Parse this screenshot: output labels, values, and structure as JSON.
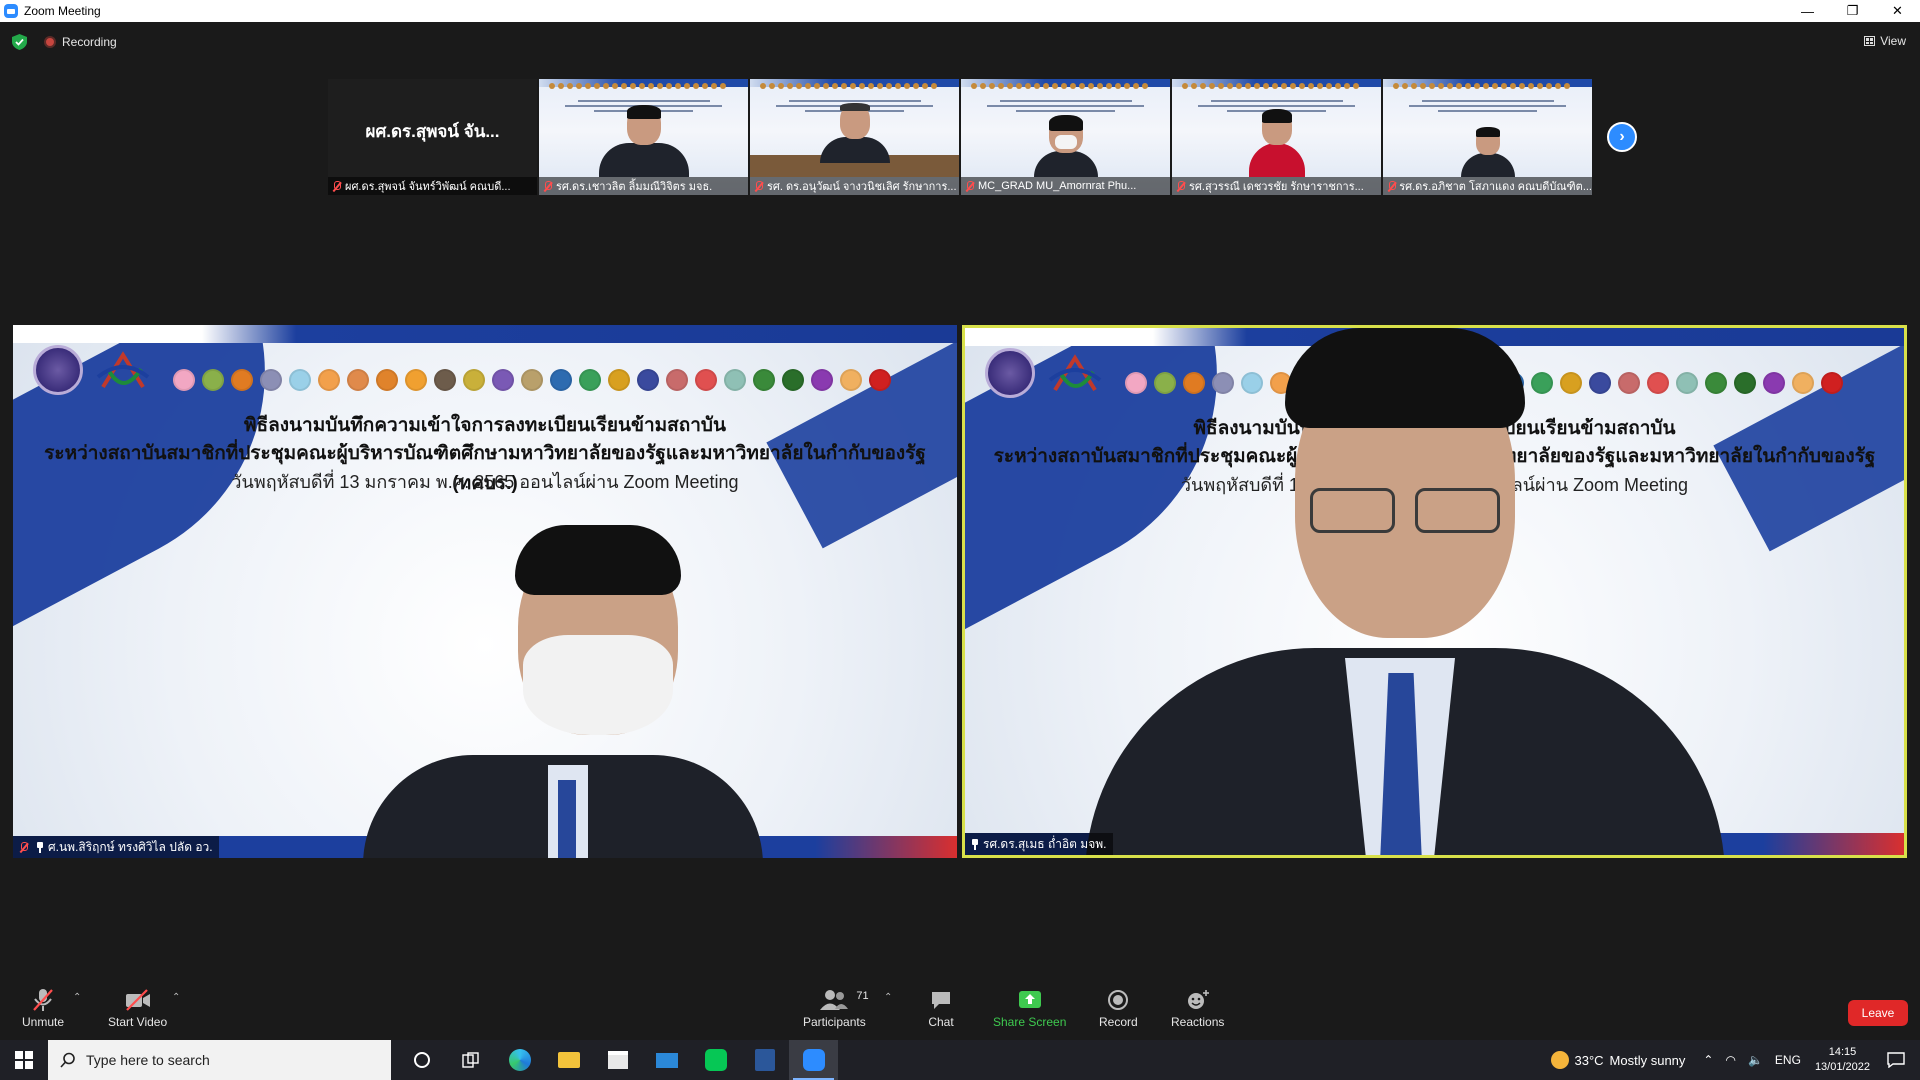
{
  "window": {
    "title": "Zoom Meeting",
    "minimize": "—",
    "restore": "❐",
    "close": "✕"
  },
  "topbar": {
    "recording_label": "Recording",
    "view_label": "View"
  },
  "thumbnails": [
    {
      "big_name": "ผศ.ดร.สุพจน์ จัน...",
      "label": "ผศ.ดร.สุพจน์ จันทร์วิพัฒน์ คณบดี..."
    },
    {
      "label": "รศ.ดร.เชาวลิต ลิ้มมณีวิจิตร มจธ."
    },
    {
      "label": "รศ. ดร.อนุวัฒน์ จางวนิชเลิศ รักษาการ..."
    },
    {
      "label": "MC_GRAD MU_Amornrat Phu..."
    },
    {
      "label": "รศ.สุวรรณี เดชวรชัย รักษาราชการ..."
    },
    {
      "label": "รศ.ดร.อภิชาต โสภาแดง คณบดีบัณฑิต..."
    }
  ],
  "slide": {
    "line1": "พิธีลงนามบันทึกความเข้าใจการลงทะเบียนเรียนข้ามสถาบัน",
    "line2": "ระหว่างสถาบันสมาชิกที่ประชุมคณะผู้บริหารบัณฑิตศึกษามหาวิทยาลัยของรัฐและมหาวิทยาลัยในกำกับของรัฐ (ทคบร.)",
    "line3": "วันพฤหัสบดีที่ 13 มกราคม พ.ศ. 2565  ออนไลน์ผ่าน Zoom Meeting"
  },
  "main_videos": {
    "left_label": "ศ.นพ.สิริฤกษ์ ทรงศิวิไล ปลัด อว.",
    "right_label": "รศ.ดร.สุเมธ ถ่ำอิต มจพ."
  },
  "toolbar": {
    "unmute": "Unmute",
    "start_video": "Start Video",
    "participants": "Participants",
    "participants_count": "71",
    "chat": "Chat",
    "share_screen": "Share Screen",
    "record": "Record",
    "reactions": "Reactions",
    "leave": "Leave"
  },
  "taskbar": {
    "search_placeholder": "Type here to search",
    "weather_temp": "33°C",
    "weather_desc": "Mostly sunny",
    "language": "ENG",
    "time": "14:15",
    "date": "13/01/2022"
  },
  "colors": {
    "zoom_blue": "#2d8cff",
    "share_green": "#3ec94f",
    "leave_red": "#e02828",
    "active_speaker_border": "#d8e04a"
  }
}
